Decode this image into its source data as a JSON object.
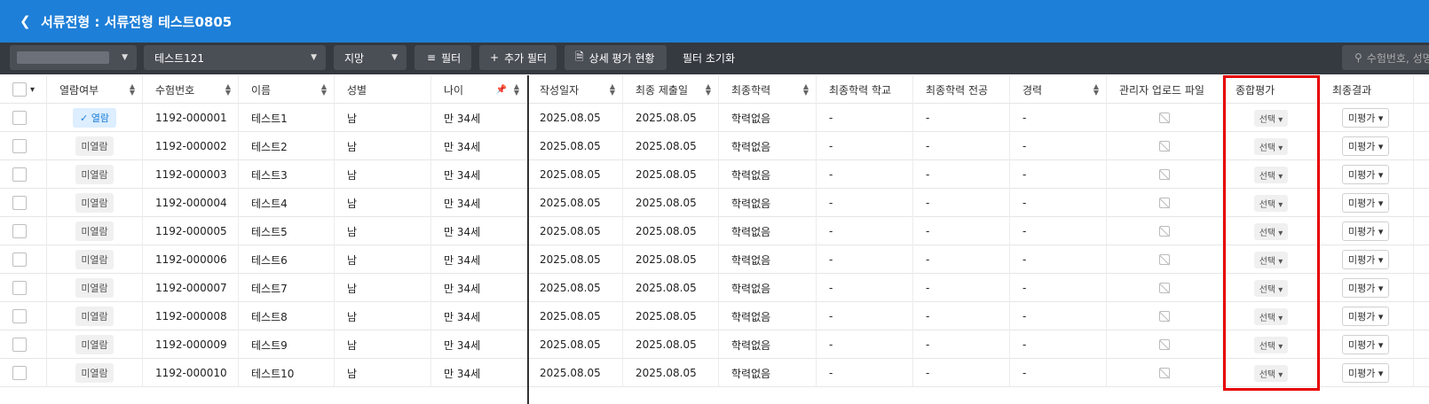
{
  "header": {
    "back_icon": "chevron-left-icon",
    "title": "서류전형 : 서류전형 테스트0805"
  },
  "toolbar": {
    "dropdown_test": "테스트121",
    "dropdown_apply": "지망",
    "filter": "필터",
    "add_filter": "추가 필터",
    "detail_status": "상세 평가 현황",
    "reset_filter": "필터 초기화",
    "search_placeholder": "수험번호, 성명"
  },
  "columns": [
    "열람여부",
    "수험번호",
    "이름",
    "성별",
    "나이",
    "작성일자",
    "최종 제출일",
    "최종학력",
    "최종학력 학교",
    "최종학력 전공",
    "경력",
    "관리자 업로드 파일",
    "종합평가",
    "최종결과"
  ],
  "rows": [
    {
      "read": "열람",
      "id": "1192-000001",
      "name": "테스트1",
      "gender": "남",
      "age": "만 34세",
      "written": "2025.08.05",
      "submitted": "2025.08.05",
      "edu": "학력없음",
      "school": "-",
      "major": "-",
      "career": "-",
      "eval": "선택",
      "result": "미평가"
    },
    {
      "read": "미열람",
      "id": "1192-000002",
      "name": "테스트2",
      "gender": "남",
      "age": "만 34세",
      "written": "2025.08.05",
      "submitted": "2025.08.05",
      "edu": "학력없음",
      "school": "-",
      "major": "-",
      "career": "-",
      "eval": "선택",
      "result": "미평가"
    },
    {
      "read": "미열람",
      "id": "1192-000003",
      "name": "테스트3",
      "gender": "남",
      "age": "만 34세",
      "written": "2025.08.05",
      "submitted": "2025.08.05",
      "edu": "학력없음",
      "school": "-",
      "major": "-",
      "career": "-",
      "eval": "선택",
      "result": "미평가"
    },
    {
      "read": "미열람",
      "id": "1192-000004",
      "name": "테스트4",
      "gender": "남",
      "age": "만 34세",
      "written": "2025.08.05",
      "submitted": "2025.08.05",
      "edu": "학력없음",
      "school": "-",
      "major": "-",
      "career": "-",
      "eval": "선택",
      "result": "미평가"
    },
    {
      "read": "미열람",
      "id": "1192-000005",
      "name": "테스트5",
      "gender": "남",
      "age": "만 34세",
      "written": "2025.08.05",
      "submitted": "2025.08.05",
      "edu": "학력없음",
      "school": "-",
      "major": "-",
      "career": "-",
      "eval": "선택",
      "result": "미평가"
    },
    {
      "read": "미열람",
      "id": "1192-000006",
      "name": "테스트6",
      "gender": "남",
      "age": "만 34세",
      "written": "2025.08.05",
      "submitted": "2025.08.05",
      "edu": "학력없음",
      "school": "-",
      "major": "-",
      "career": "-",
      "eval": "선택",
      "result": "미평가"
    },
    {
      "read": "미열람",
      "id": "1192-000007",
      "name": "테스트7",
      "gender": "남",
      "age": "만 34세",
      "written": "2025.08.05",
      "submitted": "2025.08.05",
      "edu": "학력없음",
      "school": "-",
      "major": "-",
      "career": "-",
      "eval": "선택",
      "result": "미평가"
    },
    {
      "read": "미열람",
      "id": "1192-000008",
      "name": "테스트8",
      "gender": "남",
      "age": "만 34세",
      "written": "2025.08.05",
      "submitted": "2025.08.05",
      "edu": "학력없음",
      "school": "-",
      "major": "-",
      "career": "-",
      "eval": "선택",
      "result": "미평가"
    },
    {
      "read": "미열람",
      "id": "1192-000009",
      "name": "테스트9",
      "gender": "남",
      "age": "만 34세",
      "written": "2025.08.05",
      "submitted": "2025.08.05",
      "edu": "학력없음",
      "school": "-",
      "major": "-",
      "career": "-",
      "eval": "선택",
      "result": "미평가"
    },
    {
      "read": "미열람",
      "id": "1192-000010",
      "name": "테스트10",
      "gender": "남",
      "age": "만 34세",
      "written": "2025.08.05",
      "submitted": "2025.08.05",
      "edu": "학력없음",
      "school": "-",
      "major": "-",
      "career": "-",
      "eval": "선택",
      "result": "미평가"
    }
  ],
  "colors": {
    "header_bg": "#1e7fd8",
    "toolbar_bg": "#353940",
    "highlight": "#e60000"
  }
}
